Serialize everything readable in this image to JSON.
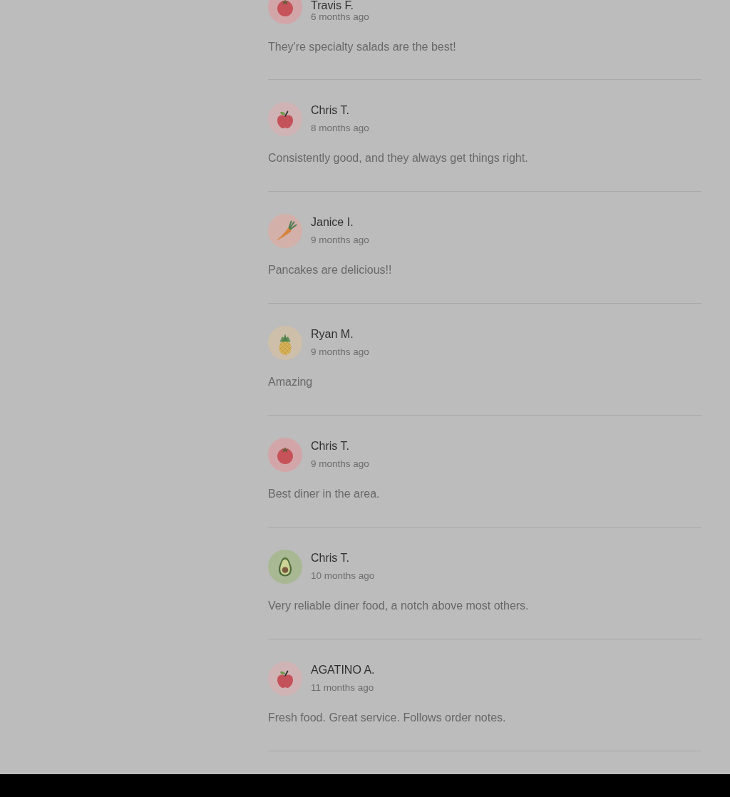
{
  "reviews": [
    {
      "author": "Travis F.",
      "time": "6 months ago",
      "text": "They're specialty salads are the best!",
      "avatar": {
        "kind": "tomato"
      }
    },
    {
      "author": "Chris T.",
      "time": "8 months ago",
      "text": "Consistently good, and they always get things right.",
      "avatar": {
        "kind": "apple"
      }
    },
    {
      "author": "Janice I.",
      "time": "9 months ago",
      "text": "Pancakes are delicious!!",
      "avatar": {
        "kind": "carrot"
      }
    },
    {
      "author": "Ryan M.",
      "time": "9 months ago",
      "text": "Amazing",
      "avatar": {
        "kind": "pineapple"
      }
    },
    {
      "author": "Chris T.",
      "time": "9 months ago",
      "text": "Best diner in the area.",
      "avatar": {
        "kind": "tomato"
      }
    },
    {
      "author": "Chris T.",
      "time": "10 months ago",
      "text": "Very reliable diner food, a notch above most others.",
      "avatar": {
        "kind": "avocado"
      }
    },
    {
      "author": "AGATINO A.",
      "time": "11 months ago",
      "text": "Fresh food. Great service. Follows order notes.",
      "avatar": {
        "kind": "apple"
      }
    }
  ]
}
